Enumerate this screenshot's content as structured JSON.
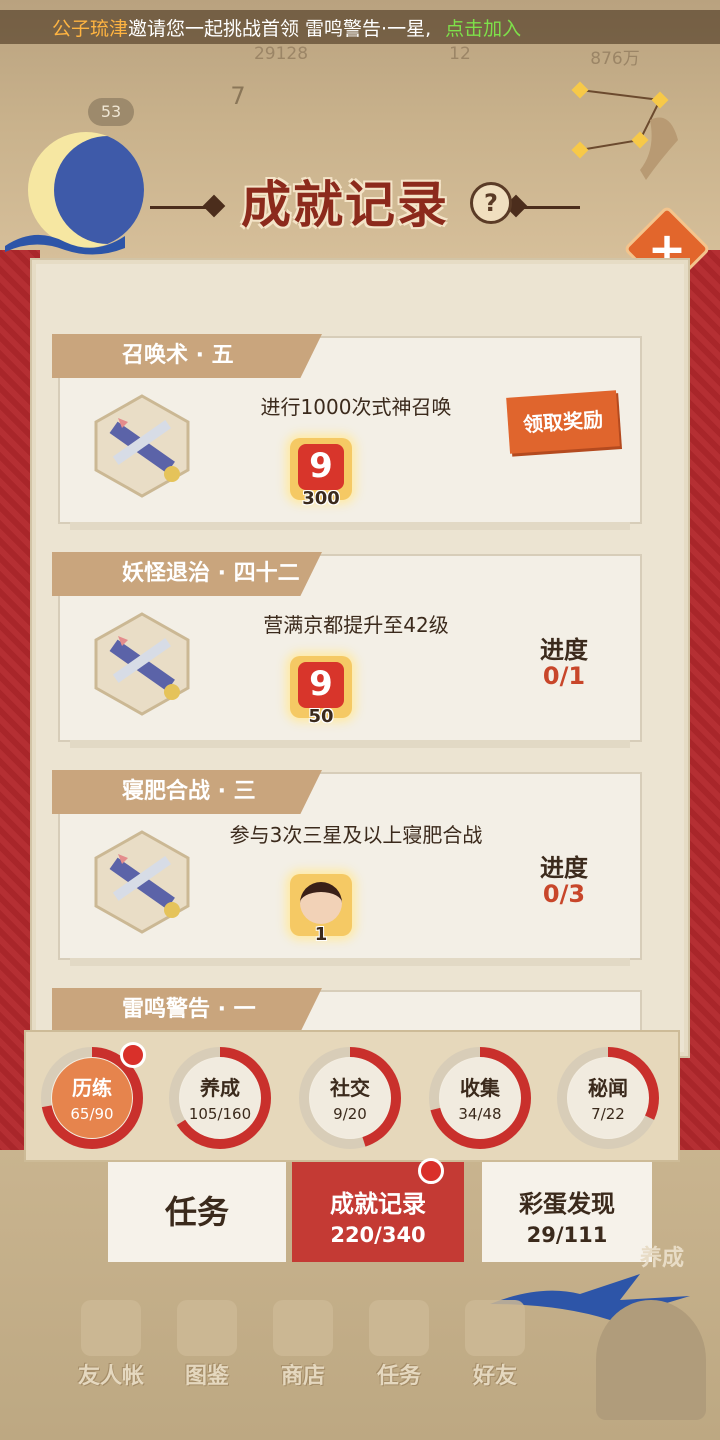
{
  "banner": {
    "inviter": "公子琉津",
    "text": "邀请您一起挑战首领 雷鸣警告·一星,",
    "join": "点击加入"
  },
  "resources": {
    "r1": "29128",
    "r2": "12",
    "r3": "876万"
  },
  "level": "53",
  "date": "7",
  "title": "成就记录",
  "help": "?",
  "add": "+",
  "cards": [
    {
      "name": "召唤术 · 五",
      "desc": "进行1000次式神召唤",
      "reward_amount": "300",
      "reward_icon": "nine-coin-icon",
      "action": "领取奖励"
    },
    {
      "name": "妖怪退治 · 四十二",
      "desc": "营满京都提升至42级",
      "reward_amount": "50",
      "reward_icon": "nine-coin-icon",
      "progress_label": "进度",
      "progress_value": "0/1"
    },
    {
      "name": "寝肥合战 · 三",
      "desc": "参与3次三星及以上寝肥合战",
      "reward_amount": "1",
      "reward_icon": "avatar-icon",
      "progress_label": "进度",
      "progress_value": "0/3"
    },
    {
      "name": "雷鸣警告 · 一"
    }
  ],
  "categories": [
    {
      "name": "历练",
      "count": "65/90",
      "progress": 0.72,
      "active": true,
      "badge": true
    },
    {
      "name": "养成",
      "count": "105/160",
      "progress": 0.66,
      "active": false,
      "badge": false
    },
    {
      "name": "社交",
      "count": "9/20",
      "progress": 0.45,
      "active": false,
      "badge": false
    },
    {
      "name": "收集",
      "count": "34/48",
      "progress": 0.71,
      "active": false,
      "badge": false
    },
    {
      "name": "秘闻",
      "count": "7/22",
      "progress": 0.32,
      "active": false,
      "badge": false
    }
  ],
  "tabs": {
    "task": "任务",
    "achievement": {
      "title": "成就记录",
      "count": "220/340"
    },
    "easter_egg": {
      "title": "彩蛋发现",
      "count": "29/111"
    }
  },
  "side_label": "养成",
  "nav": [
    "友人帐",
    "图鉴",
    "商店",
    "任务",
    "好友"
  ],
  "colors": {
    "accent_red": "#c43a34",
    "claim_orange": "#e0652d",
    "progress_red": "#c8462a",
    "ring_red": "#c9302c"
  }
}
